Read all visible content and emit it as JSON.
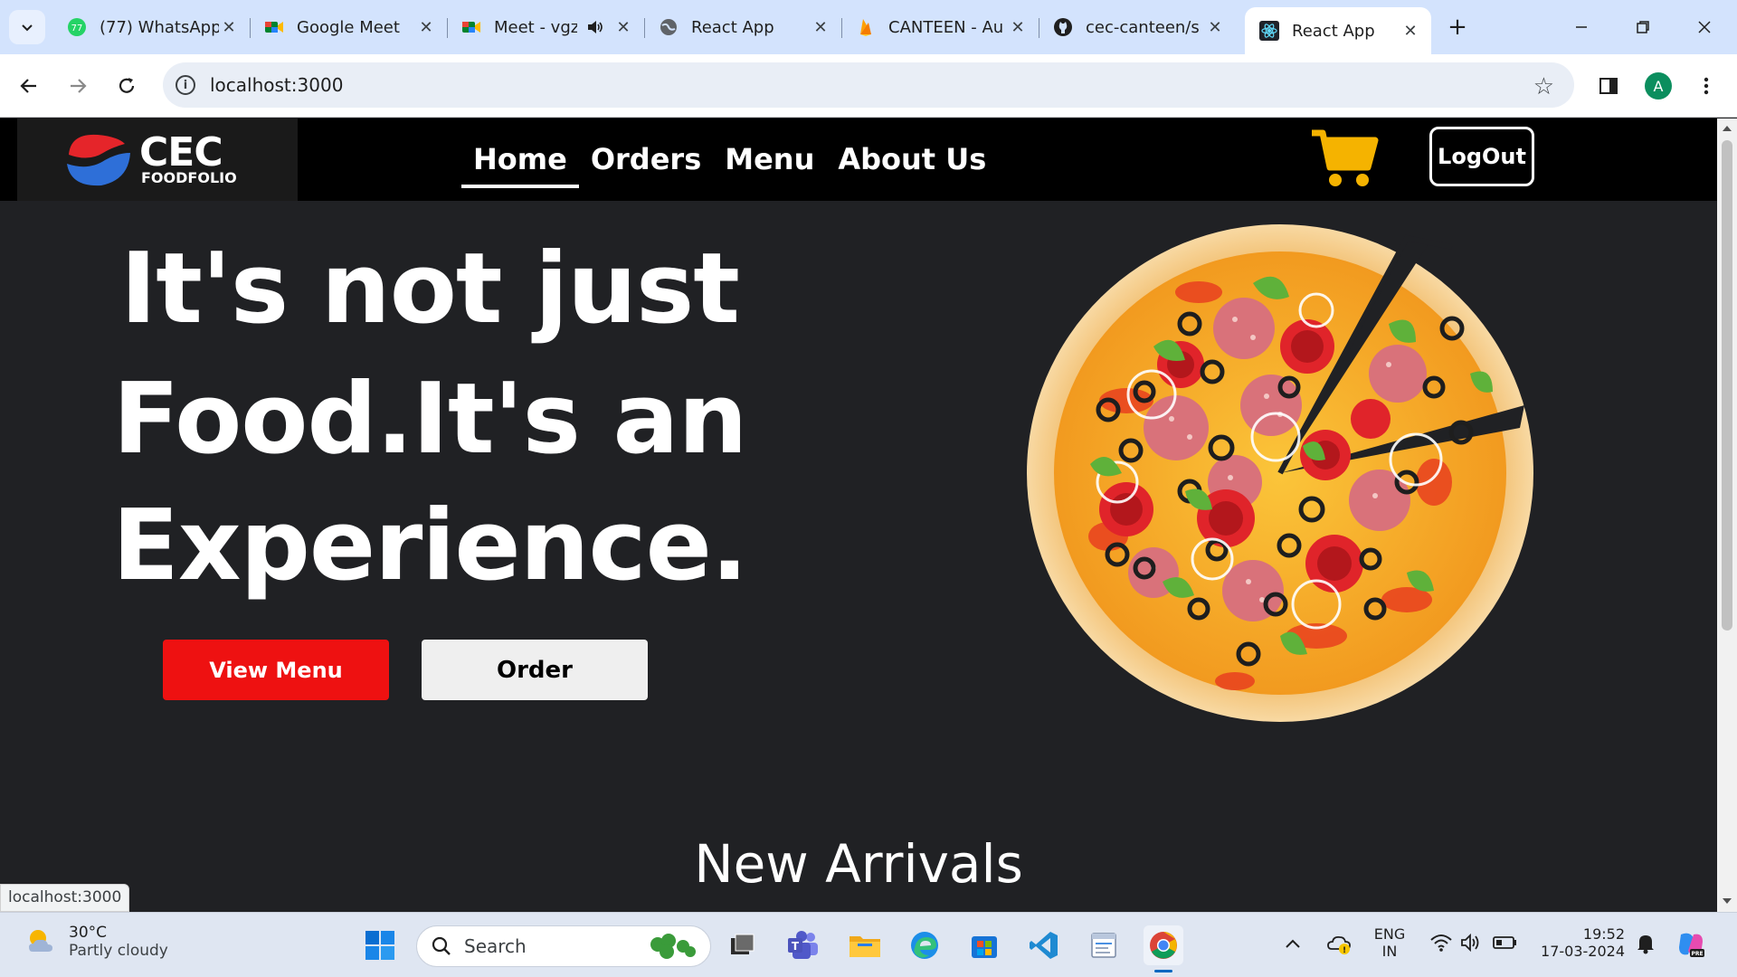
{
  "browser": {
    "tabs": [
      {
        "title": "(77) WhatsApp",
        "favicon": "whatsapp-icon",
        "badge": "77",
        "active": false
      },
      {
        "title": "Google Meet",
        "favicon": "google-meet-icon",
        "active": false
      },
      {
        "title": "Meet - vgz",
        "favicon": "google-meet-icon",
        "active": false,
        "audio": true
      },
      {
        "title": "React App",
        "favicon": "globe-icon",
        "active": false
      },
      {
        "title": "CANTEEN - Au",
        "favicon": "firebase-icon",
        "active": false
      },
      {
        "title": "cec-canteen/s",
        "favicon": "github-icon",
        "active": false
      },
      {
        "title": "React App",
        "favicon": "react-icon",
        "active": true
      }
    ],
    "url": "localhost:3000",
    "profile_initial": "A",
    "status_url": "localhost:3000"
  },
  "site": {
    "logo": {
      "name": "CEC",
      "subtitle": "FOODFOLIO"
    },
    "nav": [
      {
        "label": "Home",
        "active": true
      },
      {
        "label": "Orders",
        "active": false
      },
      {
        "label": "Menu",
        "active": false
      },
      {
        "label": "About Us",
        "active": false
      }
    ],
    "logout_label": "LogOut",
    "cart_icon": "shopping-cart-icon",
    "hero": {
      "line1": "It's not just",
      "line2": "Food.It's an",
      "line3": "Experience.",
      "view_menu_label": "View Menu",
      "order_label": "Order"
    },
    "section_title": "New Arrivals",
    "colors": {
      "accent_red": "#ee1111",
      "cart_yellow": "#f5b300",
      "page_bg": "#202124"
    }
  },
  "taskbar": {
    "weather": {
      "temp": "30°C",
      "condition": "Partly cloudy"
    },
    "search_placeholder": "Search",
    "language": {
      "line1": "ENG",
      "line2": "IN"
    },
    "time": "19:52",
    "date": "17-03-2024"
  }
}
